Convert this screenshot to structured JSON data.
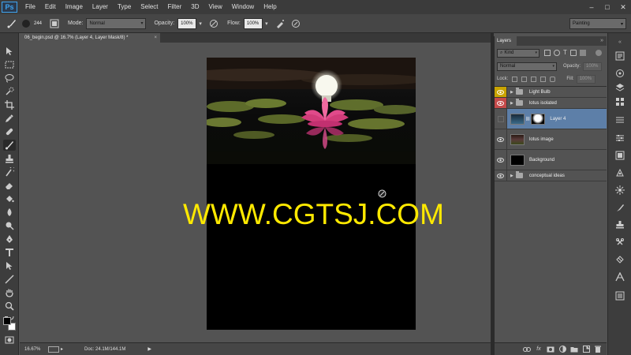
{
  "app": {
    "logo": "Ps"
  },
  "menu": [
    "File",
    "Edit",
    "Image",
    "Layer",
    "Type",
    "Select",
    "Filter",
    "3D",
    "View",
    "Window",
    "Help"
  ],
  "window_controls": {
    "minimize": "–",
    "maximize": "□",
    "close": "✕"
  },
  "options_bar": {
    "brush_size": "244",
    "mode_label": "Mode:",
    "mode_value": "Normal",
    "opacity_label": "Opacity:",
    "opacity_value": "100%",
    "flow_label": "Flow:",
    "flow_value": "100%",
    "workspace": "Painting"
  },
  "document": {
    "tab_title": "06_begin.psd @ 16.7% (Layer 4, Layer Mask/8) *",
    "close": "×",
    "watermark": "WWW.CGTSJ.COM"
  },
  "status_bar": {
    "zoom": "16.67%",
    "doc_info": "Doc: 24.1M/144.1M",
    "arrow": "▶"
  },
  "layers_panel": {
    "tab": "Layers",
    "collapse": "»",
    "filter_kind": "Kind",
    "blend_mode": "Normal",
    "opacity_label": "Opacity:",
    "opacity_value": "100%",
    "lock_label": "Lock:",
    "fill_label": "Fill:",
    "fill_value": "100%",
    "layers": [
      {
        "name": "Light Bulb",
        "type": "group",
        "eye_color": "#c9a400",
        "visible": true
      },
      {
        "name": "lotus isolated",
        "type": "group",
        "eye_color": "#c44a4a",
        "visible": true
      },
      {
        "name": "Layer 4",
        "type": "layer-with-mask",
        "selected": true,
        "visible": false
      },
      {
        "name": "lotus image",
        "type": "layer",
        "visible": true
      },
      {
        "name": "Background",
        "type": "layer",
        "visible": true
      },
      {
        "name": "conceptual ideas",
        "type": "group",
        "visible": true
      }
    ]
  },
  "colors": {
    "menubar": "#3b3b3b",
    "workspace": "#535353",
    "watermark": "#ffe900",
    "selected_layer": "#5d7fa8",
    "ps_blue": "#3fa4f0"
  }
}
